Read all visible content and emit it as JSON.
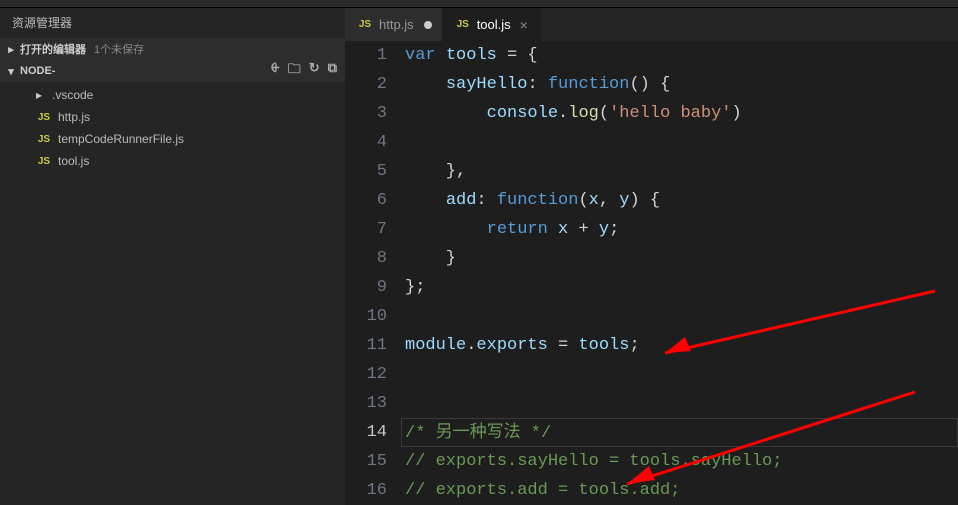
{
  "sidebar": {
    "title": "资源管理器",
    "open_editors": {
      "label": "打开的编辑器",
      "badge": "1个未保存"
    },
    "folder": {
      "name": "NODE-",
      "items": [
        {
          "type": "folder",
          "label": ".vscode"
        },
        {
          "type": "file",
          "icon": "js",
          "label": "http.js"
        },
        {
          "type": "file",
          "icon": "js",
          "label": "tempCodeRunnerFile.js"
        },
        {
          "type": "file",
          "icon": "js",
          "label": "tool.js"
        }
      ],
      "toolbar": {
        "newfile": "⨭",
        "newfolder": "🗀",
        "refresh": "↻",
        "collapse": "⧉"
      }
    }
  },
  "tabs": [
    {
      "icon": "js",
      "label": "http.js",
      "dirty": true,
      "active": false
    },
    {
      "icon": "js",
      "label": "tool.js",
      "dirty": false,
      "active": true
    }
  ],
  "editor": {
    "current_line": 14,
    "lines": [
      {
        "n": 1,
        "seg": [
          [
            "kw",
            "var"
          ],
          [
            "",
            " "
          ],
          [
            "ident",
            "tools"
          ],
          [
            "",
            " = {"
          ]
        ]
      },
      {
        "n": 2,
        "seg": [
          [
            "",
            "    "
          ],
          [
            "ident",
            "sayHello"
          ],
          [
            "",
            ": "
          ],
          [
            "kw",
            "function"
          ],
          [
            "",
            "() {"
          ]
        ]
      },
      {
        "n": 3,
        "seg": [
          [
            "",
            "        "
          ],
          [
            "ident",
            "console"
          ],
          [
            "",
            "."
          ],
          [
            "fn",
            "log"
          ],
          [
            "",
            "("
          ],
          [
            "str",
            "'hello baby'"
          ],
          [
            "",
            ")"
          ]
        ]
      },
      {
        "n": 4,
        "seg": [
          [
            "",
            ""
          ]
        ]
      },
      {
        "n": 5,
        "seg": [
          [
            "",
            "    },"
          ]
        ]
      },
      {
        "n": 6,
        "seg": [
          [
            "",
            "    "
          ],
          [
            "ident",
            "add"
          ],
          [
            "",
            ": "
          ],
          [
            "kw",
            "function"
          ],
          [
            "",
            "("
          ],
          [
            "ident",
            "x"
          ],
          [
            "",
            ", "
          ],
          [
            "ident",
            "y"
          ],
          [
            "",
            ") {"
          ]
        ]
      },
      {
        "n": 7,
        "seg": [
          [
            "",
            "        "
          ],
          [
            "kw",
            "return"
          ],
          [
            "",
            " "
          ],
          [
            "ident",
            "x"
          ],
          [
            "",
            " + "
          ],
          [
            "ident",
            "y"
          ],
          [
            "",
            ";"
          ]
        ]
      },
      {
        "n": 8,
        "seg": [
          [
            "",
            "    }"
          ]
        ]
      },
      {
        "n": 9,
        "seg": [
          [
            "",
            "};"
          ]
        ]
      },
      {
        "n": 10,
        "seg": [
          [
            "",
            ""
          ]
        ]
      },
      {
        "n": 11,
        "seg": [
          [
            "ident",
            "module"
          ],
          [
            "",
            "."
          ],
          [
            "ident",
            "exports"
          ],
          [
            "",
            " = "
          ],
          [
            "ident",
            "tools"
          ],
          [
            "",
            ";"
          ]
        ]
      },
      {
        "n": 12,
        "seg": [
          [
            "",
            ""
          ]
        ]
      },
      {
        "n": 13,
        "seg": [
          [
            "",
            ""
          ]
        ]
      },
      {
        "n": 14,
        "seg": [
          [
            "cmt",
            "/* 另一种写法 */"
          ]
        ]
      },
      {
        "n": 15,
        "seg": [
          [
            "cmt",
            "// exports.sayHello = tools.sayHello;"
          ]
        ]
      },
      {
        "n": 16,
        "seg": [
          [
            "cmt",
            "// exports.add = tools.add;"
          ]
        ]
      }
    ]
  }
}
